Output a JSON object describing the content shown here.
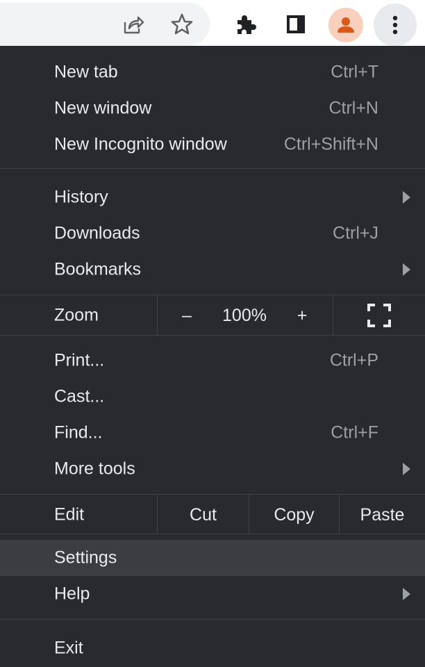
{
  "toolbar": {
    "icons": [
      "share-icon",
      "star-icon",
      "puzzle-extensions-icon",
      "side-panel-icon",
      "profile-avatar-icon",
      "more-vertical-icon"
    ],
    "accent": "#d65b1b"
  },
  "menu": {
    "new_tab": {
      "label": "New tab",
      "shortcut": "Ctrl+T"
    },
    "new_window": {
      "label": "New window",
      "shortcut": "Ctrl+N"
    },
    "new_incognito": {
      "label": "New Incognito window",
      "shortcut": "Ctrl+Shift+N"
    },
    "history": {
      "label": "History"
    },
    "downloads": {
      "label": "Downloads",
      "shortcut": "Ctrl+J"
    },
    "bookmarks": {
      "label": "Bookmarks"
    },
    "zoom": {
      "label": "Zoom",
      "minus": "–",
      "value": "100%",
      "plus": "+"
    },
    "print": {
      "label": "Print...",
      "shortcut": "Ctrl+P"
    },
    "cast": {
      "label": "Cast..."
    },
    "find": {
      "label": "Find...",
      "shortcut": "Ctrl+F"
    },
    "more_tools": {
      "label": "More tools"
    },
    "edit": {
      "label": "Edit",
      "cut": "Cut",
      "copy": "Copy",
      "paste": "Paste"
    },
    "settings": {
      "label": "Settings"
    },
    "help": {
      "label": "Help"
    },
    "exit": {
      "label": "Exit"
    }
  }
}
